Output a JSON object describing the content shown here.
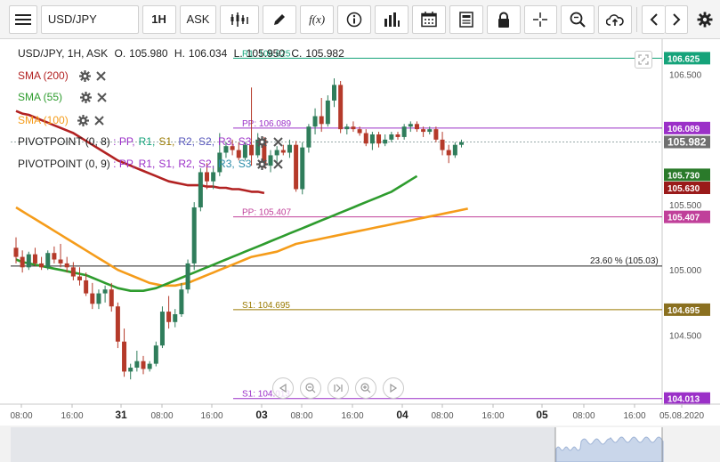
{
  "toolbar": {
    "symbol": "USD/JPY",
    "timeframe": "1H",
    "price_type": "ASK",
    "formula_label": "f(x)"
  },
  "ohlc_bar": {
    "symbol_info": "USD/JPY, 1H, ASK",
    "open_label": "O.",
    "open": "105.980",
    "high_label": "H.",
    "high": "106.034",
    "low_label": "L.",
    "low": "105.950",
    "close_label": "C.",
    "close": "105.982"
  },
  "indicators": [
    {
      "name": "SMA (200)",
      "color": "#b22222"
    },
    {
      "name": "SMA (55)",
      "color": "#2e9c2e"
    },
    {
      "name": "SMA (100)",
      "color": "#f59c1a"
    }
  ],
  "pivots": [
    {
      "name": "PIVOTPOINT (0, 8)",
      "items": [
        {
          "label": ": PP,",
          "color": "#9b30c8"
        },
        {
          "label": "R1,",
          "color": "#15a37a"
        },
        {
          "label": "S1,",
          "color": "#9a7a00"
        },
        {
          "label": "R2,",
          "color": "#5555bb"
        },
        {
          "label": "S2,",
          "color": "#5555bb"
        },
        {
          "label": "R3,",
          "color": "#9b30c8"
        },
        {
          "label": "S3",
          "color": "#9b30c8"
        }
      ]
    },
    {
      "name": "PIVOTPOINT (0, 9)",
      "items": [
        {
          "label": ": PP,",
          "color": "#9b30c8"
        },
        {
          "label": "R1,",
          "color": "#9b30c8"
        },
        {
          "label": "S1,",
          "color": "#9b30c8"
        },
        {
          "label": "R2,",
          "color": "#9b30c8"
        },
        {
          "label": "S2,",
          "color": "#9b30c8"
        },
        {
          "label": "R3,",
          "color": "#2a8aa8"
        },
        {
          "label": "S3",
          "color": "#2a8aa8"
        }
      ]
    }
  ],
  "chart_data": {
    "type": "candlestick",
    "symbol": "USD/JPY",
    "interval": "1H",
    "x_ticks": [
      "08:00",
      "16:00",
      "31",
      "08:00",
      "16:00",
      "03",
      "08:00",
      "16:00",
      "04",
      "08:00",
      "16:00",
      "05",
      "08:00",
      "16:00",
      "05.08.2020"
    ],
    "x_tick_bold": [
      false,
      false,
      true,
      false,
      false,
      true,
      false,
      false,
      true,
      false,
      false,
      true,
      false,
      false,
      false
    ],
    "y_ticks": [
      104.5,
      105.0,
      105.5,
      106.0,
      106.5
    ],
    "y_tick_labels": [
      "104.500",
      "105.000",
      "105.500",
      "106.000",
      "106.500"
    ],
    "ylim": [
      103.97,
      106.73
    ],
    "candles": [
      {
        "o": 105.17,
        "h": 105.25,
        "l": 105.05,
        "c": 105.1
      },
      {
        "o": 105.1,
        "h": 105.15,
        "l": 104.98,
        "c": 105.02
      },
      {
        "o": 105.02,
        "h": 105.14,
        "l": 105.0,
        "c": 105.12
      },
      {
        "o": 105.12,
        "h": 105.17,
        "l": 105.03,
        "c": 105.05
      },
      {
        "o": 105.05,
        "h": 105.1,
        "l": 105.0,
        "c": 105.02
      },
      {
        "o": 105.02,
        "h": 105.15,
        "l": 105.0,
        "c": 105.13
      },
      {
        "o": 105.13,
        "h": 105.18,
        "l": 105.05,
        "c": 105.08
      },
      {
        "o": 105.08,
        "h": 105.2,
        "l": 105.02,
        "c": 105.05
      },
      {
        "o": 105.05,
        "h": 105.1,
        "l": 104.98,
        "c": 105.02
      },
      {
        "o": 105.02,
        "h": 105.06,
        "l": 104.92,
        "c": 104.95
      },
      {
        "o": 104.95,
        "h": 105.02,
        "l": 104.88,
        "c": 104.92
      },
      {
        "o": 104.92,
        "h": 104.98,
        "l": 104.8,
        "c": 104.82
      },
      {
        "o": 104.82,
        "h": 104.9,
        "l": 104.7,
        "c": 104.74
      },
      {
        "o": 104.74,
        "h": 104.85,
        "l": 104.7,
        "c": 104.82
      },
      {
        "o": 104.82,
        "h": 104.88,
        "l": 104.75,
        "c": 104.85
      },
      {
        "o": 104.85,
        "h": 104.9,
        "l": 104.68,
        "c": 104.72
      },
      {
        "o": 104.72,
        "h": 104.75,
        "l": 104.4,
        "c": 104.45
      },
      {
        "o": 104.45,
        "h": 104.55,
        "l": 104.18,
        "c": 104.22
      },
      {
        "o": 104.22,
        "h": 104.28,
        "l": 104.16,
        "c": 104.25
      },
      {
        "o": 104.25,
        "h": 104.38,
        "l": 104.22,
        "c": 104.3
      },
      {
        "o": 104.3,
        "h": 104.34,
        "l": 104.2,
        "c": 104.24
      },
      {
        "o": 104.24,
        "h": 104.3,
        "l": 104.22,
        "c": 104.28
      },
      {
        "o": 104.28,
        "h": 104.45,
        "l": 104.26,
        "c": 104.42
      },
      {
        "o": 104.42,
        "h": 104.72,
        "l": 104.4,
        "c": 104.68
      },
      {
        "o": 104.68,
        "h": 104.8,
        "l": 104.55,
        "c": 104.6
      },
      {
        "o": 104.6,
        "h": 104.7,
        "l": 104.56,
        "c": 104.66
      },
      {
        "o": 104.66,
        "h": 104.9,
        "l": 104.64,
        "c": 104.85
      },
      {
        "o": 104.85,
        "h": 105.08,
        "l": 104.82,
        "c": 105.05
      },
      {
        "o": 105.05,
        "h": 105.52,
        "l": 105.0,
        "c": 105.48
      },
      {
        "o": 105.48,
        "h": 105.78,
        "l": 105.45,
        "c": 105.75
      },
      {
        "o": 105.75,
        "h": 105.82,
        "l": 105.62,
        "c": 105.68
      },
      {
        "o": 105.68,
        "h": 105.8,
        "l": 105.62,
        "c": 105.75
      },
      {
        "o": 105.75,
        "h": 106.05,
        "l": 105.72,
        "c": 105.9
      },
      {
        "o": 105.9,
        "h": 105.98,
        "l": 105.86,
        "c": 105.95
      },
      {
        "o": 105.95,
        "h": 106.0,
        "l": 105.88,
        "c": 105.92
      },
      {
        "o": 105.92,
        "h": 105.98,
        "l": 105.84,
        "c": 105.86
      },
      {
        "o": 105.86,
        "h": 105.98,
        "l": 105.84,
        "c": 105.96
      },
      {
        "o": 105.96,
        "h": 106.4,
        "l": 105.8,
        "c": 105.88
      },
      {
        "o": 105.88,
        "h": 106.05,
        "l": 105.86,
        "c": 106.0
      },
      {
        "o": 106.0,
        "h": 106.02,
        "l": 105.78,
        "c": 105.8
      },
      {
        "o": 105.8,
        "h": 105.92,
        "l": 105.75,
        "c": 105.88
      },
      {
        "o": 105.88,
        "h": 105.95,
        "l": 105.8,
        "c": 105.92
      },
      {
        "o": 105.92,
        "h": 105.96,
        "l": 105.88,
        "c": 105.9
      },
      {
        "o": 105.9,
        "h": 106.0,
        "l": 105.86,
        "c": 105.96
      },
      {
        "o": 105.96,
        "h": 105.99,
        "l": 105.6,
        "c": 105.62
      },
      {
        "o": 105.62,
        "h": 105.98,
        "l": 105.58,
        "c": 105.94
      },
      {
        "o": 105.94,
        "h": 106.12,
        "l": 105.9,
        "c": 106.1
      },
      {
        "o": 106.1,
        "h": 106.24,
        "l": 106.04,
        "c": 106.18
      },
      {
        "o": 106.18,
        "h": 106.32,
        "l": 106.06,
        "c": 106.12
      },
      {
        "o": 106.12,
        "h": 106.34,
        "l": 106.1,
        "c": 106.3
      },
      {
        "o": 106.3,
        "h": 106.47,
        "l": 106.25,
        "c": 106.42
      },
      {
        "o": 106.42,
        "h": 106.45,
        "l": 106.05,
        "c": 106.08
      },
      {
        "o": 106.08,
        "h": 106.12,
        "l": 106.04,
        "c": 106.1
      },
      {
        "o": 106.1,
        "h": 106.14,
        "l": 106.06,
        "c": 106.08
      },
      {
        "o": 106.08,
        "h": 106.1,
        "l": 106.03,
        "c": 106.05
      },
      {
        "o": 106.05,
        "h": 106.08,
        "l": 105.95,
        "c": 105.97
      },
      {
        "o": 105.97,
        "h": 106.06,
        "l": 105.92,
        "c": 106.04
      },
      {
        "o": 106.04,
        "h": 106.06,
        "l": 105.94,
        "c": 105.97
      },
      {
        "o": 105.97,
        "h": 106.04,
        "l": 105.95,
        "c": 106.0
      },
      {
        "o": 106.0,
        "h": 106.06,
        "l": 105.98,
        "c": 106.04
      },
      {
        "o": 106.04,
        "h": 106.06,
        "l": 106.0,
        "c": 106.02
      },
      {
        "o": 106.02,
        "h": 106.12,
        "l": 106.0,
        "c": 106.1
      },
      {
        "o": 106.1,
        "h": 106.14,
        "l": 106.06,
        "c": 106.12
      },
      {
        "o": 106.12,
        "h": 106.14,
        "l": 106.06,
        "c": 106.08
      },
      {
        "o": 106.08,
        "h": 106.1,
        "l": 106.02,
        "c": 106.06
      },
      {
        "o": 106.06,
        "h": 106.1,
        "l": 106.04,
        "c": 106.08
      },
      {
        "o": 106.08,
        "h": 106.1,
        "l": 105.98,
        "c": 106.0
      },
      {
        "o": 106.0,
        "h": 106.06,
        "l": 105.88,
        "c": 105.92
      },
      {
        "o": 105.92,
        "h": 105.96,
        "l": 105.82,
        "c": 105.88
      },
      {
        "o": 105.88,
        "h": 105.98,
        "l": 105.86,
        "c": 105.96
      },
      {
        "o": 105.96,
        "h": 106.0,
        "l": 105.94,
        "c": 105.98
      }
    ],
    "sma_200": [
      106.22,
      106.2,
      106.19,
      106.17,
      106.15,
      106.13,
      106.11,
      106.09,
      106.07,
      106.05,
      106.02,
      105.99,
      105.96,
      105.93,
      105.9,
      105.87,
      105.84,
      105.82,
      105.8,
      105.78,
      105.76,
      105.74,
      105.72,
      105.7,
      105.68,
      105.67,
      105.66,
      105.65,
      105.65,
      105.65,
      105.64,
      105.64,
      105.63,
      105.63,
      105.62,
      105.62,
      105.61,
      105.6,
      105.6,
      105.59
    ],
    "sma_200_start_index": 32,
    "sma_55": [
      105.08,
      105.06,
      105.05,
      105.04,
      105.03,
      105.02,
      105.01,
      105.0,
      104.99,
      104.98,
      104.97,
      104.96,
      104.94,
      104.92,
      104.9,
      104.88,
      104.86,
      104.85,
      104.84,
      104.84,
      104.84,
      104.85,
      104.86,
      104.88,
      104.9,
      104.92,
      104.94,
      104.96,
      104.98,
      105.0,
      105.02,
      105.04,
      105.06,
      105.08,
      105.1,
      105.12,
      105.14,
      105.16,
      105.18,
      105.2,
      105.22,
      105.24,
      105.26,
      105.28,
      105.3,
      105.32,
      105.34,
      105.36,
      105.38,
      105.4,
      105.42,
      105.44,
      105.46,
      105.48,
      105.5,
      105.52,
      105.54,
      105.56,
      105.58,
      105.6,
      105.63,
      105.66,
      105.69,
      105.72
    ],
    "sma_55_start_index": 0,
    "sma_100": [
      105.48,
      105.45,
      105.42,
      105.39,
      105.36,
      105.33,
      105.3,
      105.27,
      105.24,
      105.21,
      105.18,
      105.15,
      105.12,
      105.09,
      105.06,
      105.03,
      105.0,
      104.98,
      104.96,
      104.94,
      104.92,
      104.9,
      104.89,
      104.88,
      104.88,
      104.88,
      104.89,
      104.9,
      104.92,
      104.94,
      104.96,
      104.98,
      105.0,
      105.02,
      105.04,
      105.06,
      105.08,
      105.1,
      105.11,
      105.12,
      105.13,
      105.14,
      105.16,
      105.18,
      105.2,
      105.21,
      105.22,
      105.23,
      105.24,
      105.25,
      105.26,
      105.27,
      105.28,
      105.29,
      105.3,
      105.31,
      105.32,
      105.33,
      105.34,
      105.35,
      105.36,
      105.37,
      105.38,
      105.39,
      105.4,
      105.41,
      105.42,
      105.43,
      105.44,
      105.45,
      105.46,
      105.47
    ],
    "sma_100_start_index": 0,
    "pivot_levels": [
      {
        "label": "R1: 106.625",
        "value": 106.625,
        "color": "#15a37a",
        "x_start_label": 272
      },
      {
        "label": "PP: 106.089",
        "value": 106.089,
        "color": "#9b30c8",
        "x_start_label": 272
      },
      {
        "label": "PP: 105.407",
        "value": 105.407,
        "color": "#c0409a",
        "x_start_label": 272
      },
      {
        "label": "S1: 104.695",
        "value": 104.695,
        "color": "#9a7a00",
        "x_start_label": 272
      },
      {
        "label": "S1: 104.013",
        "value": 104.013,
        "color": "#9b30c8",
        "x_start_label": 272
      }
    ],
    "fib_level": {
      "label": "23.60 % (105.03)",
      "value": 105.03
    },
    "price_tags": [
      {
        "value": "106.625",
        "price": 106.625,
        "bg": "#15a37a"
      },
      {
        "value": "106.089",
        "price": 106.089,
        "bg": "#9b30c8"
      },
      {
        "value": "105.982",
        "price": 105.982,
        "bg": "#707070"
      },
      {
        "value": "105.730",
        "price": 105.73,
        "bg": "#2a7a2a"
      },
      {
        "value": "105.630",
        "price": 105.63,
        "bg": "#9a1a1a"
      },
      {
        "value": "105.407",
        "price": 105.407,
        "bg": "#c0409a"
      },
      {
        "value": "104.695",
        "price": 104.695,
        "bg": "#8a7020"
      },
      {
        "value": "104.013",
        "price": 104.013,
        "bg": "#9b30c8"
      }
    ],
    "current_price": 105.982
  },
  "colors": {
    "bull": "#2f7d5b",
    "bear": "#b53a2a",
    "sma200": "#b22222",
    "sma55": "#2e9c2e",
    "sma100": "#f59c1a"
  }
}
